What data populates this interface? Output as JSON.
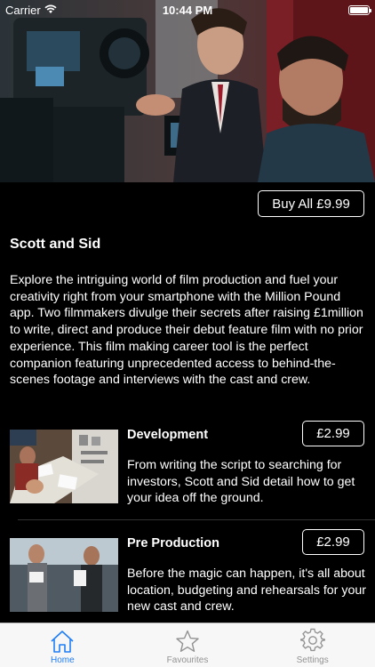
{
  "status_bar": {
    "carrier": "Carrier",
    "time": "10:44 PM",
    "battery_level": 1.0
  },
  "hero": {
    "image": "film-crew-on-set"
  },
  "buy_all_label": "Buy All £9.99",
  "title": "Scott and Sid",
  "description": "Explore the intriguing world of film production and fuel your creativity right from your smartphone with the Million Pound app. Two filmmakers divulge their secrets after raising £1million to write, direct and produce their debut feature film with no prior experience. This film making career tool is the perfect companion featuring unprecedented access to behind-the-scenes footage and interviews with the cast and crew.",
  "items": [
    {
      "title": "Development",
      "price": "£2.99",
      "description": "From writing the script to searching for investors, Scott and Sid detail how to get your idea off the ground.",
      "image": "script-papers-on-table"
    },
    {
      "title": "Pre Production",
      "price": "£2.99",
      "description": "Before the magic can happen, it's all about location, budgeting and rehearsals for your new cast and crew.",
      "image": "actors-rehearsing"
    }
  ],
  "tabs": [
    {
      "label": "Home",
      "icon": "home-icon",
      "active": true
    },
    {
      "label": "Favourites",
      "icon": "star-icon",
      "active": false
    },
    {
      "label": "Settings",
      "icon": "gear-icon",
      "active": false
    }
  ],
  "colors": {
    "background": "#000000",
    "tab_active": "#1f7ef6",
    "tab_inactive": "#929292",
    "tab_bar_bg": "#f7f7f7"
  }
}
